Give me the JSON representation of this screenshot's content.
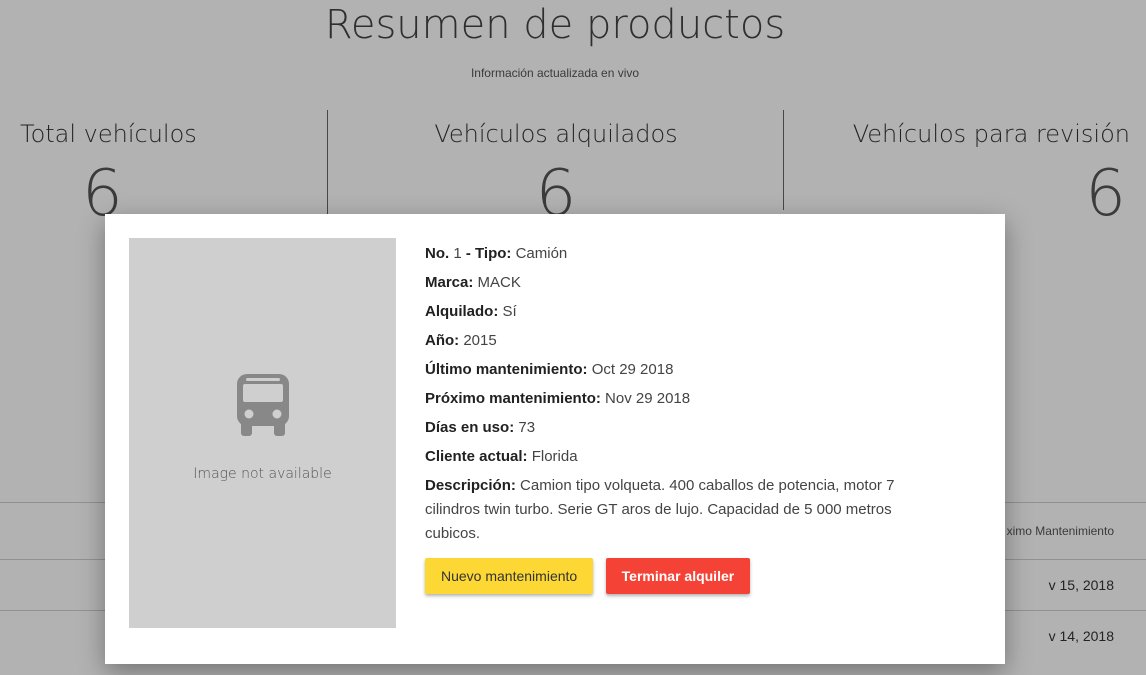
{
  "page": {
    "title": "Resumen de productos",
    "subtitle": "Información actualizada en vivo",
    "stats": [
      {
        "label": "Total vehículos",
        "value": "6"
      },
      {
        "label": "Vehículos alquilados",
        "value": "6"
      },
      {
        "label": "Vehículos para revisión",
        "value": "6"
      }
    ],
    "table": {
      "header_visible": "ximo Mantenimiento",
      "rows_visible": [
        "v 15, 2018",
        "v 14, 2018"
      ]
    }
  },
  "modal": {
    "image_placeholder": "Image not available",
    "image_icon": "bus-icon",
    "fields": {
      "no_label": "No.",
      "no_value": "1",
      "tipo_label": "- Tipo:",
      "tipo_value": "Camión",
      "marca_label": "Marca:",
      "marca_value": "MACK",
      "alquilado_label": "Alquilado:",
      "alquilado_value": "Sí",
      "anio_label": "Año:",
      "anio_value": "2015",
      "ultimo_label": "Último mantenimiento:",
      "ultimo_value": "Oct 29 2018",
      "proximo_label": "Próximo mantenimiento:",
      "proximo_value": "Nov 29 2018",
      "dias_label": "Días en uso:",
      "dias_value": "73",
      "cliente_label": "Cliente actual:",
      "cliente_value": "Florida",
      "descripcion_label": "Descripción:",
      "descripcion_value": "Camion tipo volqueta. 400 caballos de potencia, motor 7 cilindros twin turbo. Serie GT aros de lujo. Capacidad de 5 000 metros cubicos."
    },
    "buttons": {
      "maintenance": "Nuevo mantenimiento",
      "end_rental": "Terminar alquiler"
    },
    "colors": {
      "yellow_button": "#fdd835",
      "red_button": "#f44336"
    }
  }
}
